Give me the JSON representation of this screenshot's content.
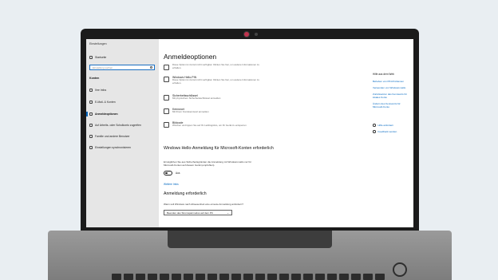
{
  "window": {
    "title": "Einstellungen"
  },
  "sidebar": {
    "home": "Startseite",
    "search_placeholder": "Einstellung suchen",
    "section": "Konten",
    "items": [
      {
        "label": "Ihre Infos"
      },
      {
        "label": "E-Mail- & Konten"
      },
      {
        "label": "Anmeldeoptionen"
      },
      {
        "label": "Auf Arbeits- oder Schulkonto zugreifen"
      },
      {
        "label": "Familie und andere Benutzer"
      },
      {
        "label": "Einstellungen synchronisieren"
      }
    ],
    "active_index": 2
  },
  "main": {
    "title": "Anmeldeoptionen",
    "options": [
      {
        "title": "",
        "desc": "Diese Option ist zurzeit nicht verfügbar. Klicken Sie hier, um weitere Informationen zu erhalten."
      },
      {
        "title": "Windows Hello-PIN",
        "desc": "Diese Option ist zurzeit nicht verfügbar. Klicken Sie hier, um weitere Informationen zu erhalten."
      },
      {
        "title": "Sicherheitsschlüssel",
        "desc": "Mit physischem Sicherheitsschlüssel anmelden"
      },
      {
        "title": "Kennwort",
        "desc": "Mit Ihrem Kontokennwort anmelden"
      },
      {
        "title": "Bildcode",
        "desc": "Wischen und tippen Sie auf Ihr Lieblingsfoto, um Ihr Gerät zu entsperren"
      }
    ],
    "hello_heading": "Windows Hello-Anmeldung für Microsoft-Konten erforderlich",
    "hello_desc": "Ermöglichen Sie aus Sicherheitsgründen die Anmeldung mit Windows Hello nur für Microsoft-Konten auf diesem Gerät (empfohlen).",
    "toggle_label": "Aus",
    "more_info": "Weitere Infos",
    "required_heading": "Anmeldung erforderlich",
    "required_question": "Wann soll Windows nach Abwesenheit eine erneute Anmeldung anfordern?",
    "dropdown_value": "Beenden des Stromsparmodus auf dem PC"
  },
  "help": {
    "heading": "Hilfe aus dem Web",
    "links": [
      "Beheben von PIN-Problemen",
      "Verwenden von Windows Hello",
      "Zurücksetzen des Kennworts für lokales Konto",
      "Ändern des Kennworts für Microsoft-Konto"
    ],
    "get_help": "Hilfe anfordern",
    "feedback": "Feedback senden"
  },
  "colors": {
    "accent": "#0067c0",
    "sidebar_bg": "#e6e6e6",
    "bezel": "#1b1b1b",
    "page_bg": "#e9eef2"
  }
}
